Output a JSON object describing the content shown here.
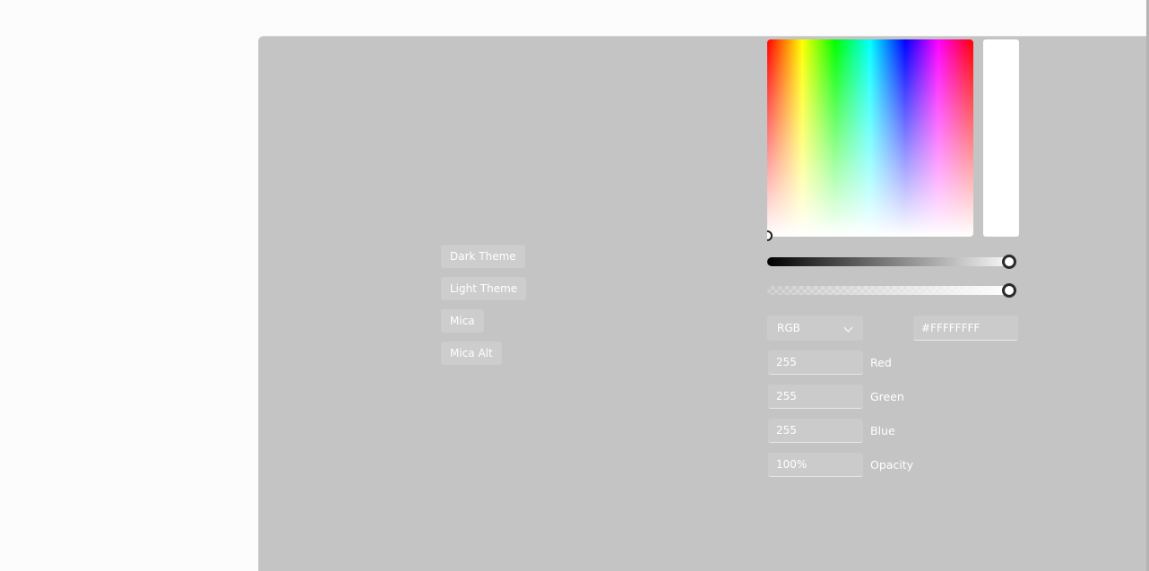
{
  "theme_buttons": [
    {
      "label": "Dark Theme"
    },
    {
      "label": "Light Theme"
    },
    {
      "label": "Mica"
    },
    {
      "label": "Mica Alt"
    }
  ],
  "color_picker": {
    "current_color": "#FFFFFFFF",
    "value_level": 1.0,
    "opacity_level": 1.0,
    "mode": "RGB",
    "hex_value": "#FFFFFFFF",
    "channels": [
      {
        "value": "255",
        "label": "Red"
      },
      {
        "value": "255",
        "label": "Green"
      },
      {
        "value": "255",
        "label": "Blue"
      },
      {
        "value": "100%",
        "label": "Opacity"
      }
    ]
  }
}
